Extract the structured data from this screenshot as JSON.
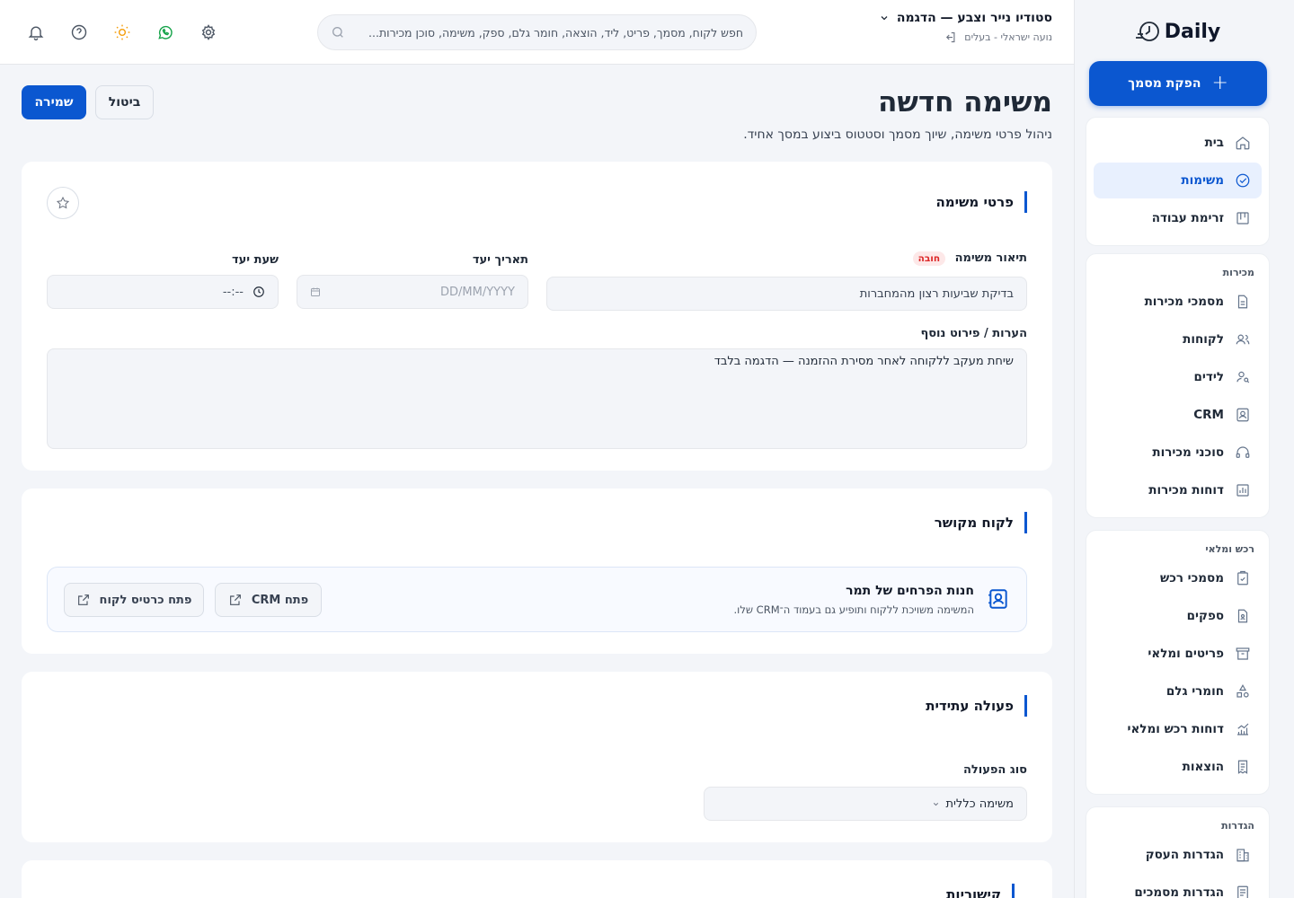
{
  "sidebar": {
    "logo": "Daily",
    "cta_label": "הפקת מסמך",
    "main_items": [
      {
        "label": "בית"
      },
      {
        "label": "משימות"
      },
      {
        "label": "זרימת עבודה"
      }
    ],
    "sales_section": "מכירות",
    "sales_items": [
      {
        "label": "מסמכי מכירות"
      },
      {
        "label": "לקוחות"
      },
      {
        "label": "לידים"
      },
      {
        "label": "CRM"
      },
      {
        "label": "סוכני מכירות"
      },
      {
        "label": "דוחות מכירות"
      }
    ],
    "purchase_section": "רכש ומלאי",
    "purchase_items": [
      {
        "label": "מסמכי רכש"
      },
      {
        "label": "ספקים"
      },
      {
        "label": "פריטים ומלאי"
      },
      {
        "label": "חומרי גלם"
      },
      {
        "label": "דוחות רכש ומלאי"
      },
      {
        "label": "הוצאות"
      }
    ],
    "settings_section": "הגדרות",
    "settings_items": [
      {
        "label": "הגדרות העסק"
      },
      {
        "label": "הגדרות מסמכים"
      }
    ]
  },
  "topbar": {
    "business_name": "סטודיו נייר וצבע — הדגמה",
    "user": "נועה ישראלי - בעלים",
    "search_placeholder": "חפש לקוח, מסמך, פריט, ליד, הוצאה, חומר גלם, ספק, משימה, סוכן מכירות..."
  },
  "page": {
    "title": "משימה חדשה",
    "subtitle": "ניהול פרטי משימה, שיוך מסמך וסטטוס ביצוע במסך אחיד.",
    "save_label": "שמירה",
    "cancel_label": "ביטול"
  },
  "task_details": {
    "title": "פרטי משימה",
    "description_label": "תיאור משימה",
    "required_badge": "חובה",
    "description_value": "בדיקת שביעות רצון מהמחברות",
    "due_date_label": "תאריך יעד",
    "due_date_placeholder": "DD/MM/YYYY",
    "due_time_label": "שעת יעד",
    "due_time_placeholder": "--:--",
    "notes_label": "הערות / פירוט נוסף",
    "notes_value": "שיחת מעקב ללקוחה לאחר מסירת ההזמנה — הדגמה בלבד"
  },
  "linked_customer": {
    "title": "לקוח מקושר",
    "name": "חנות הפרחים של תמר",
    "description": "המשימה משויכת ללקוח ותופיע גם בעמוד ה־CRM שלו.",
    "open_crm": "פתח CRM",
    "open_card": "פתח כרטיס לקוח"
  },
  "future_action": {
    "title": "פעולה עתידית",
    "type_label": "סוג הפעולה",
    "type_value": "משימה כללית"
  },
  "links": {
    "title": "קישוריות"
  },
  "colors": {
    "accent": "#0b57d0",
    "whatsapp": "#16a34a",
    "sun": "#f59e0b",
    "required": "#dc2626"
  }
}
